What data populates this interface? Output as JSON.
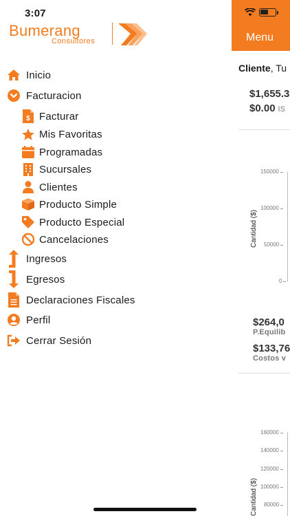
{
  "status": {
    "time": "3:07"
  },
  "logo": {
    "name": "Bumerang",
    "subtitle": "Consultores"
  },
  "menu": {
    "top_items": [
      {
        "label": "Inicio",
        "icon": "home-icon"
      },
      {
        "label": "Facturacion",
        "icon": "chevron-down-circle-icon"
      }
    ],
    "sub_items": [
      {
        "label": "Facturar",
        "icon": "invoice-dollar-icon"
      },
      {
        "label": "Mis Favoritas",
        "icon": "star-icon"
      },
      {
        "label": "Programadas",
        "icon": "calendar-icon"
      },
      {
        "label": "Sucursales",
        "icon": "building-icon"
      },
      {
        "label": "Clientes",
        "icon": "user-icon"
      },
      {
        "label": "Producto Simple",
        "icon": "box-icon"
      },
      {
        "label": "Producto Especial",
        "icon": "tag-icon"
      },
      {
        "label": "Cancelaciones",
        "icon": "ban-icon"
      }
    ],
    "bottom_items": [
      {
        "label": "Ingresos",
        "icon": "arrow-up-icon"
      },
      {
        "label": "Egresos",
        "icon": "arrow-down-icon"
      },
      {
        "label": "Declaraciones Fiscales",
        "icon": "document-icon"
      },
      {
        "label": "Perfil",
        "icon": "user-circle-icon"
      },
      {
        "label": "Cerrar Sesión",
        "icon": "sign-out-icon"
      }
    ]
  },
  "content": {
    "header_label": "Menu",
    "cliente_prefix": "Cliente",
    "cliente_rest": ", Tu",
    "amount1": "$1,655.3",
    "amount2": "$0.00",
    "amount2_suffix": "IS",
    "chart1": {
      "ylabel": "Cantidad ($)",
      "ticks": [
        "150000",
        "100000",
        "50000",
        "0"
      ]
    },
    "amount3": "$264,0",
    "amount3_label": "P.Equilib",
    "amount4": "$133,76",
    "amount4_label": "Costos v",
    "chart2": {
      "ylabel": "Cantidad ($)",
      "ticks": [
        "160000",
        "140000",
        "120000",
        "100000",
        "80000"
      ]
    }
  },
  "colors": {
    "accent": "#f47c20"
  }
}
